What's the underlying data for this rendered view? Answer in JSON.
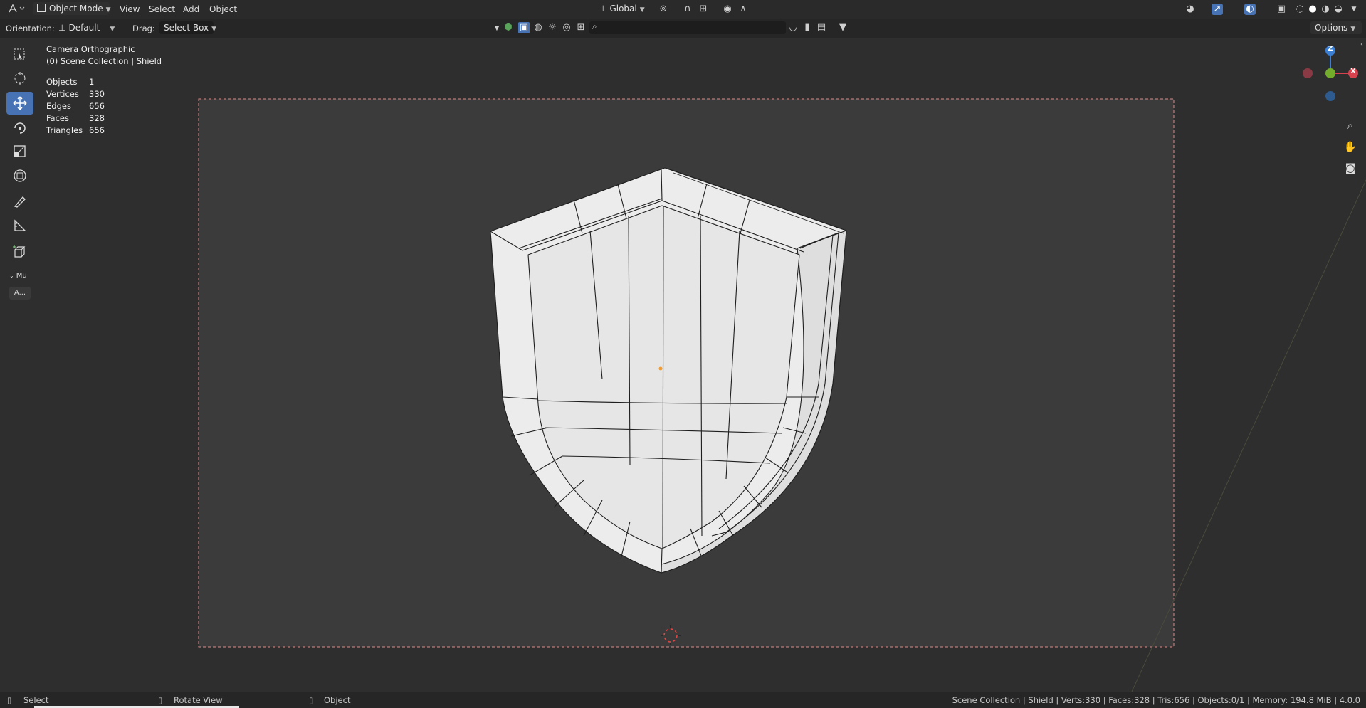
{
  "header": {
    "mode": "Object Mode",
    "menus": [
      "View",
      "Select",
      "Add",
      "Object"
    ],
    "transform_orientation": "Global"
  },
  "tool_settings": {
    "orientation_label": "Orientation:",
    "orientation_value": "Default",
    "drag_label": "Drag:",
    "drag_value": "Select Box",
    "options_label": "Options"
  },
  "overlay": {
    "view_name": "Camera Orthographic",
    "collection": "(0) Scene Collection | Shield",
    "stats": [
      {
        "label": "Objects",
        "value": "1"
      },
      {
        "label": "Vertices",
        "value": "330"
      },
      {
        "label": "Edges",
        "value": "656"
      },
      {
        "label": "Faces",
        "value": "328"
      },
      {
        "label": "Triangles",
        "value": "656"
      }
    ]
  },
  "toolbar": {
    "tools": [
      "select-box-tool",
      "cursor-tool",
      "move-tool",
      "rotate-tool",
      "scale-tool",
      "transform-tool",
      "annotate-tool",
      "measure-tool",
      "add-cube-tool"
    ],
    "active_tool": "move-tool",
    "panel_label": "Mu",
    "panel_item": "A..."
  },
  "gizmo": {
    "x": "X",
    "y": "Y",
    "z": "Z"
  },
  "statusbar": {
    "left_mouse": "Select",
    "middle_mouse": "Rotate View",
    "right_mouse": "Object",
    "info": "Scene Collection | Shield | Verts:330 | Faces:328 | Tris:656 | Objects:0/1 | Memory: 194.8 MiB | 4.0.0"
  },
  "colors": {
    "accent": "#4772b3",
    "axis_x": "#d8414e",
    "axis_y": "#74ad2b",
    "axis_z": "#3b7fd4",
    "camera_frame": "#d98b8b"
  }
}
